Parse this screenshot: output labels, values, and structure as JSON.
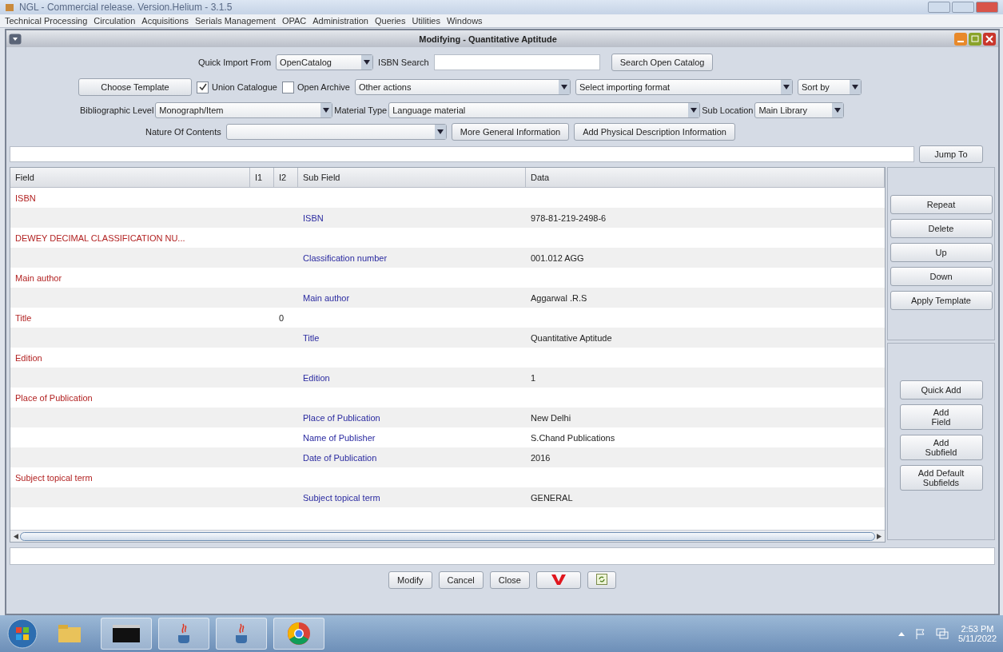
{
  "app_window": {
    "title": "NGL - Commercial release. Version.Helium - 3.1.5"
  },
  "menu": [
    "Technical Processing",
    "Circulation",
    "Acquisitions",
    "Serials Management",
    "OPAC",
    "Administration",
    "Queries",
    "Utilities",
    "Windows"
  ],
  "frame": {
    "title": "Modifying - Quantitative Aptitude"
  },
  "quick_import": {
    "label": "Quick Import From",
    "source": "OpenCatalog",
    "isbn_label": "ISBN Search",
    "search_button": "Search Open Catalog"
  },
  "options_row": {
    "template_button": "Choose Template",
    "checkboxes": [
      {
        "label": "Union Catalogue",
        "checked": true
      },
      {
        "label": "Open Archive",
        "checked": false
      }
    ],
    "other_actions": "Other actions",
    "import_format": "Select importing format",
    "sort_by": "Sort by"
  },
  "level_row": {
    "bibliographic_label": "Bibliographic Level",
    "bibliographic_value": "Monograph/Item",
    "material_label": "Material Type",
    "material_value": "Language material",
    "sub_location_label": "Sub Location",
    "sub_location_value": "Main Library"
  },
  "contents_row": {
    "label": "Nature Of Contents",
    "buttons": [
      "More General Information",
      "Add Physical Description Information"
    ]
  },
  "jump_button": "Jump To",
  "table": {
    "columns": [
      "Field",
      "I1",
      "I2",
      "Sub Field",
      "Data"
    ],
    "rows": [
      {
        "kind": "field",
        "field": "ISBN"
      },
      {
        "kind": "subfield",
        "subfield": "ISBN",
        "data": "978-81-219-2498-6"
      },
      {
        "kind": "field",
        "field": "DEWEY DECIMAL CLASSIFICATION NU..."
      },
      {
        "kind": "subfield",
        "subfield": "Classification number",
        "data": "001.012 AGG"
      },
      {
        "kind": "field",
        "field": "Main author"
      },
      {
        "kind": "subfield",
        "subfield": "Main author",
        "data": "Aggarwal .R.S"
      },
      {
        "kind": "field",
        "field": "Title",
        "i2": "0"
      },
      {
        "kind": "subfield",
        "subfield": "Title",
        "data": "Quantitative Aptitude"
      },
      {
        "kind": "field",
        "field": "Edition"
      },
      {
        "kind": "subfield",
        "subfield": "Edition",
        "data": "1"
      },
      {
        "kind": "field",
        "field": "Place of Publication"
      },
      {
        "kind": "subfield",
        "subfield": "Place of Publication",
        "data": "New Delhi"
      },
      {
        "kind": "subfield",
        "subfield": "Name of Publisher",
        "data": "S.Chand Publications"
      },
      {
        "kind": "subfield",
        "subfield": "Date of Publication",
        "data": "2016"
      },
      {
        "kind": "field",
        "field": "Subject topical term"
      },
      {
        "kind": "subfield",
        "subfield": "Subject topical term",
        "data": "GENERAL"
      }
    ]
  },
  "side_buttons_top": [
    "Repeat",
    "Delete",
    "Up",
    "Down",
    "Apply Template"
  ],
  "side_buttons_bottom": [
    "Quick Add",
    "Add\nField",
    "Add\nSubfield",
    "Add Default\nSubfields"
  ],
  "bottom_buttons": [
    "Modify",
    "Cancel",
    "Close"
  ],
  "clock": {
    "time": "2:53 PM",
    "date": "5/11/2022"
  }
}
